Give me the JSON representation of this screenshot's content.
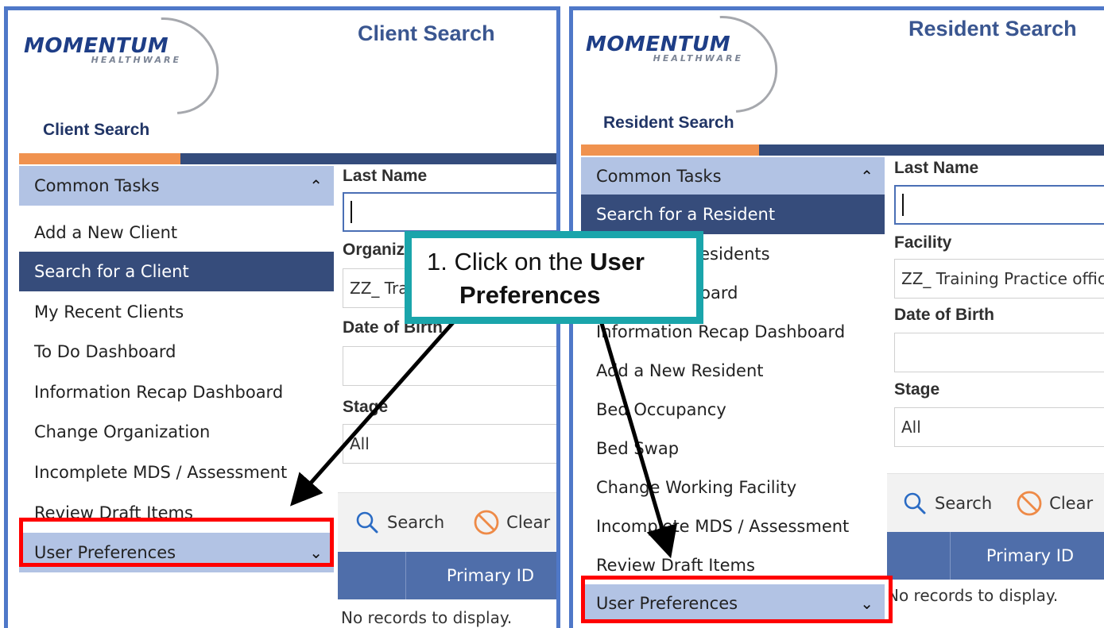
{
  "callout": {
    "step_prefix": "1. Click on the",
    "step_bold": "User",
    "step_line2": "Preferences"
  },
  "client_panel": {
    "logo_main": "MOMENTUM",
    "logo_sub": "HEALTHWARE",
    "header_title": "Client Search",
    "sub_title": "Client Search",
    "menu": {
      "head": "Common Tasks",
      "items": [
        "Add a New Client",
        "Search for a Client",
        "My Recent Clients",
        "To Do Dashboard",
        "Information Recap Dashboard",
        "Change Organization",
        "Incomplete MDS / Assessment",
        "Review Draft Items"
      ],
      "selected_index": 1,
      "footer": "User Preferences"
    },
    "form": {
      "last_name_label": "Last Name",
      "last_name_value": "",
      "org_label": "Organization",
      "org_value": "ZZ_ Training Practice office",
      "dob_label": "Date of Birth",
      "dob_value": "",
      "stage_label": "Stage",
      "stage_value": "All"
    },
    "toolbar": {
      "search": "Search",
      "clear": "Clear Search"
    },
    "grid": {
      "col_primary": "Primary ID",
      "empty": "No records to display."
    }
  },
  "resident_panel": {
    "logo_main": "MOMENTUM",
    "logo_sub": "HEALTHWARE",
    "header_title": "Resident Search",
    "sub_title": "Resident Search",
    "menu": {
      "head": "Common Tasks",
      "items": [
        "Search for a Resident",
        "My Recent Residents",
        "To Do Dashboard",
        "Information Recap Dashboard",
        "Add a New Resident",
        "Bed Occupancy",
        "Bed Swap",
        "Change Working Facility",
        "Incomplete MDS / Assessment",
        "Review Draft Items"
      ],
      "selected_index": 0,
      "footer": "User Preferences"
    },
    "form": {
      "last_name_label": "Last Name",
      "last_name_value": "",
      "facility_label": "Facility",
      "facility_value": "ZZ_ Training Practice office",
      "dob_label": "Date of Birth",
      "dob_value": "",
      "stage_label": "Stage",
      "stage_value": "All"
    },
    "toolbar": {
      "search": "Search",
      "clear": "Clear"
    },
    "grid": {
      "col_primary": "Primary ID",
      "empty": "No records to display."
    }
  },
  "colors": {
    "panel_border": "#4f78c8",
    "menu_head": "#b2c3e4",
    "menu_selected": "#364c7b",
    "accent_orange": "#f0924f",
    "callout_border": "#1aa5ab",
    "highlight_red": "#ff0000"
  }
}
